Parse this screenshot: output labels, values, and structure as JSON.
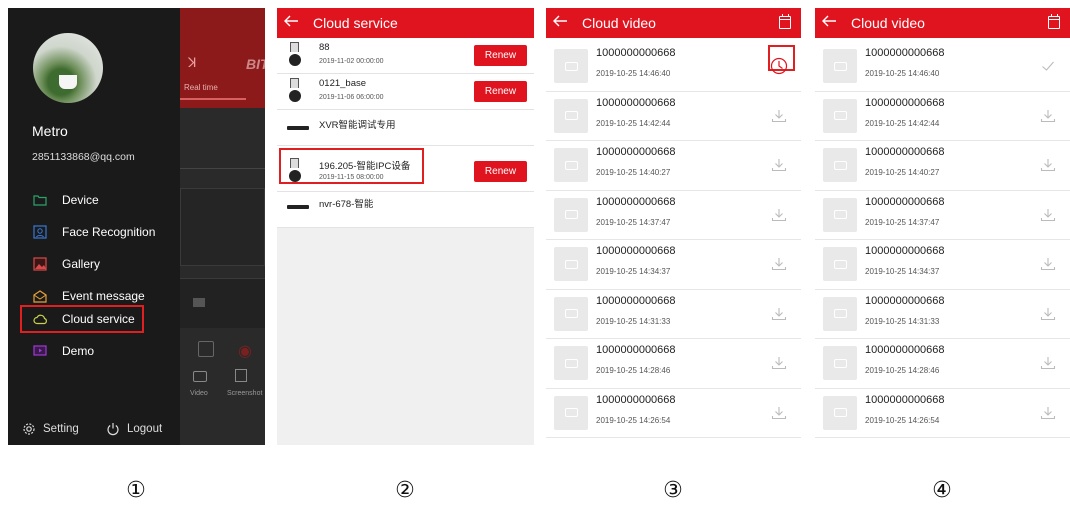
{
  "panel1": {
    "user_name": "Metro",
    "email": "2851133868@qq.com",
    "menu": [
      {
        "label": "Device",
        "icon": "folder-icon",
        "color": "#2ba36b"
      },
      {
        "label": "Face Recognition",
        "icon": "face-scan-icon",
        "color": "#3a79d6"
      },
      {
        "label": "Gallery",
        "icon": "image-icon",
        "color": "#d84a4a"
      },
      {
        "label": "Event message",
        "icon": "envelope-icon",
        "color": "#e6a13a"
      },
      {
        "label": "Cloud service",
        "icon": "cloud-icon",
        "color": "#c9d24a"
      },
      {
        "label": "Demo",
        "icon": "play-icon",
        "color": "#a03ad6"
      }
    ],
    "setting_label": "Setting",
    "logout_label": "Logout",
    "background": {
      "tab_label": "Real time",
      "brand": "BIT",
      "video_label": "Video",
      "screenshot_label": "Screenshot"
    }
  },
  "panel2": {
    "title": "Cloud service",
    "renew_label": "Renew",
    "devices": [
      {
        "name": "88",
        "date": "2019-11-02 00:00:00",
        "kind": "camera",
        "renew": true
      },
      {
        "name": "0121_base",
        "date": "2019-11-06 06:00:00",
        "kind": "camera",
        "renew": true
      },
      {
        "name": "XVR智能调试专用",
        "date": "",
        "kind": "nvr",
        "renew": false
      },
      {
        "name": "196.205-智能IPC设备",
        "date": "2019-11-15 08:00:00",
        "kind": "camera",
        "renew": true
      },
      {
        "name": "nvr-678-智能",
        "date": "",
        "kind": "nvr",
        "renew": false
      }
    ]
  },
  "panel3": {
    "title": "Cloud video",
    "videos": [
      {
        "id": "1000000000668",
        "time": "2019-10-25 14:46:40",
        "state": "downloading"
      },
      {
        "id": "1000000000668",
        "time": "2019-10-25 14:42:44",
        "state": "download"
      },
      {
        "id": "1000000000668",
        "time": "2019-10-25 14:40:27",
        "state": "download"
      },
      {
        "id": "1000000000668",
        "time": "2019-10-25 14:37:47",
        "state": "download"
      },
      {
        "id": "1000000000668",
        "time": "2019-10-25 14:34:37",
        "state": "download"
      },
      {
        "id": "1000000000668",
        "time": "2019-10-25 14:31:33",
        "state": "download"
      },
      {
        "id": "1000000000668",
        "time": "2019-10-25 14:28:46",
        "state": "download"
      },
      {
        "id": "1000000000668",
        "time": "2019-10-25 14:26:54",
        "state": "download"
      }
    ]
  },
  "panel4": {
    "title": "Cloud video",
    "videos": [
      {
        "id": "1000000000668",
        "time": "2019-10-25 14:46:40",
        "state": "done"
      },
      {
        "id": "1000000000668",
        "time": "2019-10-25 14:42:44",
        "state": "download"
      },
      {
        "id": "1000000000668",
        "time": "2019-10-25 14:40:27",
        "state": "download"
      },
      {
        "id": "1000000000668",
        "time": "2019-10-25 14:37:47",
        "state": "download"
      },
      {
        "id": "1000000000668",
        "time": "2019-10-25 14:34:37",
        "state": "download"
      },
      {
        "id": "1000000000668",
        "time": "2019-10-25 14:31:33",
        "state": "download"
      },
      {
        "id": "1000000000668",
        "time": "2019-10-25 14:28:46",
        "state": "download"
      },
      {
        "id": "1000000000668",
        "time": "2019-10-25 14:26:54",
        "state": "download"
      }
    ]
  },
  "step_labels": [
    "①",
    "②",
    "③",
    "④"
  ],
  "colors": {
    "accent": "#e0141f",
    "highlight": "#e02020"
  }
}
